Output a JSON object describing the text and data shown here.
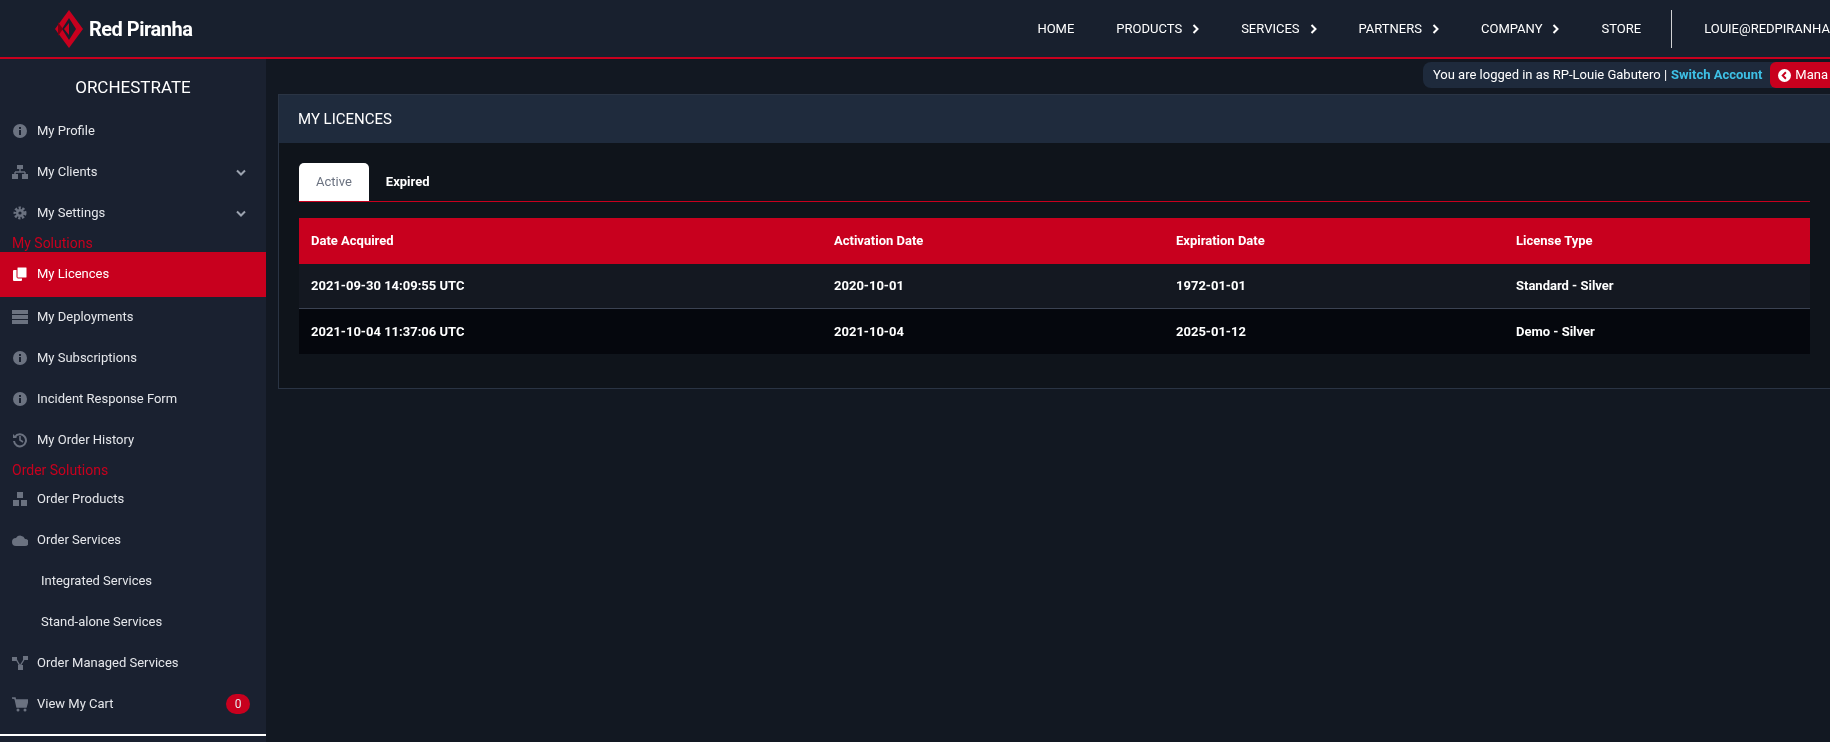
{
  "brand": {
    "name": "Red Piranha"
  },
  "nav": {
    "items": [
      {
        "label": "HOME",
        "has_submenu": false
      },
      {
        "label": "PRODUCTS",
        "has_submenu": true
      },
      {
        "label": "SERVICES",
        "has_submenu": true
      },
      {
        "label": "PARTNERS",
        "has_submenu": true
      },
      {
        "label": "COMPANY",
        "has_submenu": true
      },
      {
        "label": "STORE",
        "has_submenu": false
      }
    ],
    "user": "LOUIE@REDPIRANHA"
  },
  "sidebar": {
    "title": "ORCHESTRATE",
    "items": [
      {
        "kind": "item",
        "label": "My Profile",
        "expandable": false,
        "selected": false
      },
      {
        "kind": "item",
        "label": "My Clients",
        "expandable": true,
        "selected": false
      },
      {
        "kind": "item",
        "label": "My Settings",
        "expandable": true,
        "selected": false
      },
      {
        "kind": "section",
        "label": "My Solutions"
      },
      {
        "kind": "item",
        "label": "My Licences",
        "expandable": false,
        "selected": true
      },
      {
        "kind": "item",
        "label": "My Deployments",
        "expandable": false,
        "selected": false
      },
      {
        "kind": "item",
        "label": "My Subscriptions",
        "expandable": false,
        "selected": false
      },
      {
        "kind": "item",
        "label": "Incident Response Form",
        "expandable": false,
        "selected": false
      },
      {
        "kind": "item",
        "label": "My Order History",
        "expandable": false,
        "selected": false
      },
      {
        "kind": "section",
        "label": "Order Solutions"
      },
      {
        "kind": "item",
        "label": "Order Products",
        "expandable": false,
        "selected": false
      },
      {
        "kind": "item",
        "label": "Order Services",
        "expandable": false,
        "selected": false
      },
      {
        "kind": "subitem",
        "label": "Integrated Services",
        "selected": false
      },
      {
        "kind": "subitem",
        "label": "Stand-alone Services",
        "selected": false
      },
      {
        "kind": "item",
        "label": "Order Managed Services",
        "expandable": false,
        "selected": false
      },
      {
        "kind": "item",
        "label": "View My Cart",
        "expandable": false,
        "selected": false,
        "badge": "0"
      }
    ]
  },
  "login_bar": {
    "text": "You are logged in as RP-Louie Gabutero |",
    "link": "Switch Account",
    "button": "Mana"
  },
  "panel": {
    "title": "MY LICENCES",
    "tabs": [
      {
        "label": "Active",
        "selected": true
      },
      {
        "label": "Expired",
        "selected": false
      }
    ],
    "table": {
      "columns": [
        "Date Acquired",
        "Activation Date",
        "Expiration Date",
        "License Type"
      ],
      "rows": [
        [
          "2021-09-30 14:09:55 UTC",
          "2020-10-01",
          "1972-01-01",
          "Standard - Silver"
        ],
        [
          "2021-10-04 11:37:06 UTC",
          "2021-10-04",
          "2025-01-12",
          "Demo - Silver"
        ]
      ]
    }
  }
}
